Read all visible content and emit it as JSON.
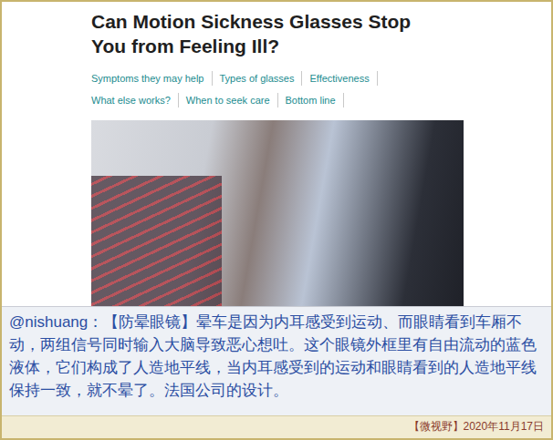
{
  "article": {
    "title_lines": [
      "Can Motion Sickness Glasses Stop",
      "You from Feeling Ill?"
    ],
    "nav_rows": [
      [
        "Symptoms they may help",
        "Types of glasses",
        "Effectiveness"
      ],
      [
        "What else works?",
        "When to seek care",
        "Bottom line"
      ]
    ]
  },
  "caption": {
    "author": "@nishuang：",
    "text": "【防晕眼镜】晕车是因为内耳感受到运动、而眼睛看到车厢不动，两组信号同时输入大脑导致恶心想吐。这个眼镜外框里有自由流动的蓝色液体，它们构成了人造地平线，当内耳感受到的运动和眼睛看到的人造地平线保持一致，就不晕了。法国公司的设计。"
  },
  "footer": {
    "source": "【微视野】2020年11月17日"
  }
}
